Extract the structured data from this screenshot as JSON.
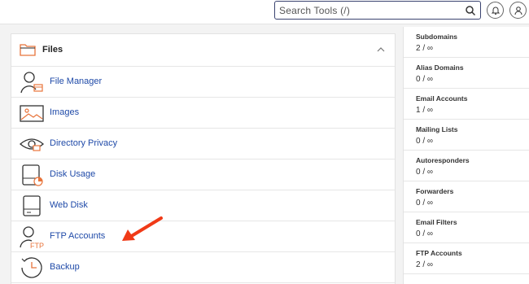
{
  "search": {
    "placeholder": "Search Tools (/)"
  },
  "header_icons": [
    "bell-icon",
    "user-icon"
  ],
  "files": {
    "title": "Files",
    "items": [
      {
        "label": "File Manager",
        "icon": "file-manager-icon"
      },
      {
        "label": "Images",
        "icon": "images-icon"
      },
      {
        "label": "Directory Privacy",
        "icon": "eye-icon"
      },
      {
        "label": "Disk Usage",
        "icon": "disk-usage-icon"
      },
      {
        "label": "Web Disk",
        "icon": "web-disk-icon"
      },
      {
        "label": "FTP Accounts",
        "icon": "ftp-icon"
      },
      {
        "label": "Backup",
        "icon": "backup-icon"
      }
    ]
  },
  "stats": [
    {
      "name": "Subdomains",
      "value": "2 / ∞"
    },
    {
      "name": "Alias Domains",
      "value": "0 / ∞"
    },
    {
      "name": "Email Accounts",
      "value": "1 / ∞"
    },
    {
      "name": "Mailing Lists",
      "value": "0 / ∞"
    },
    {
      "name": "Autoresponders",
      "value": "0 / ∞"
    },
    {
      "name": "Forwarders",
      "value": "0 / ∞"
    },
    {
      "name": "Email Filters",
      "value": "0 / ∞"
    },
    {
      "name": "FTP Accounts",
      "value": "2 / ∞"
    }
  ],
  "colors": {
    "accent": "#e8743b",
    "link": "#1f4aa8",
    "arrow": "#f03a17"
  }
}
